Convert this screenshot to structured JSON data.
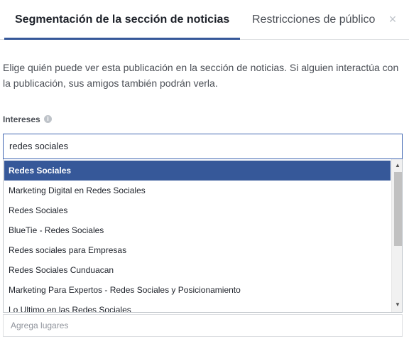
{
  "tabs": {
    "active": "Segmentación de la sección de noticias",
    "inactive": "Restricciones de público"
  },
  "close_glyph": "×",
  "description": "Elige quién puede ver esta publicación en la sección de noticias. Si alguien interactúa con la publicación, sus amigos también podrán verla.",
  "interests": {
    "label": "Intereses",
    "info_glyph": "i",
    "value": "redes sociales"
  },
  "suggestions": [
    "Redes Sociales",
    "Marketing Digital en Redes Sociales",
    "Redes Sociales",
    "BlueTie - Redes Sociales",
    "Redes sociales para Empresas",
    "Redes Sociales Cunduacan",
    "Marketing Para Expertos - Redes Sociales y Posicionamiento",
    "Lo Ultimo en las Redes Sociales"
  ],
  "selected_index": 0,
  "scroll": {
    "up": "▲",
    "down": "▼"
  },
  "places": {
    "placeholder": "Agrega lugares"
  },
  "colors": {
    "accent": "#365899",
    "input_border": "#4267b2"
  }
}
